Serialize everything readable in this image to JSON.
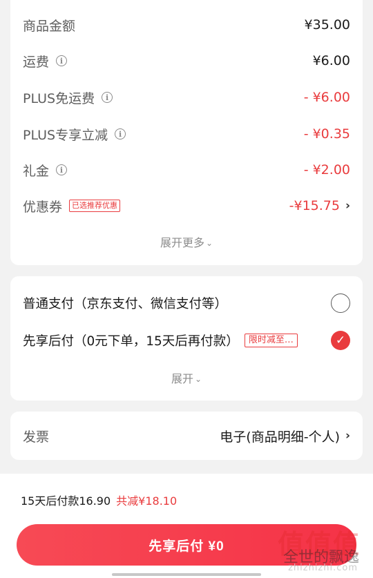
{
  "price": {
    "rows": [
      {
        "label": "商品金额",
        "value": "¥35.00"
      },
      {
        "label": "运费",
        "value": "¥6.00"
      },
      {
        "label": "PLUS免运费",
        "value": "- ¥6.00"
      },
      {
        "label": "PLUS专享立减",
        "value": "- ¥0.35"
      },
      {
        "label": "礼金",
        "value": "- ¥2.00"
      },
      {
        "label": "优惠券",
        "value": "-¥15.75",
        "tag": "已选推荐优惠"
      }
    ],
    "expand_label": "展开更多"
  },
  "payment": {
    "options": [
      {
        "label": "普通支付（京东支付、微信支付等）",
        "selected": false
      },
      {
        "label": "先享后付（0元下单，15天后再付款）",
        "tag": "限时减至…",
        "selected": true
      }
    ],
    "expand_label": "展开"
  },
  "invoice": {
    "label": "发票",
    "value": "电子(商品明细-个人)"
  },
  "footer": {
    "summary_text": "15天后付款16.90",
    "savings_text": "共减¥18.10",
    "submit_label": "先享后付 ¥0"
  },
  "icons": {
    "info": "info-circle-icon",
    "chevron": "chevron-right-icon",
    "check": "checkmark-icon",
    "expand": "chevron-down-icon"
  },
  "colors": {
    "accent": "#e93b3d",
    "background": "#f2f2f2"
  },
  "watermark": {
    "line1": "值值值",
    "line2": "全世的飘逸",
    "line3": "zhizhizhi.com"
  }
}
